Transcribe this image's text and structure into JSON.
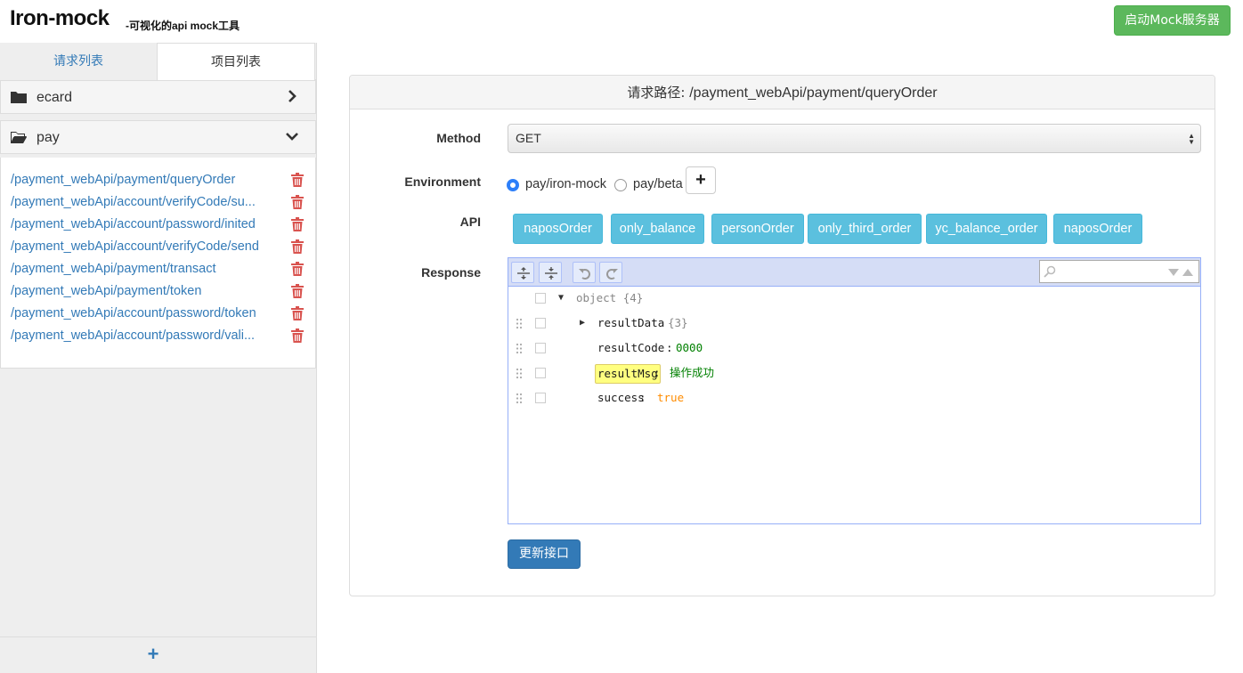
{
  "header": {
    "title": "Iron-mock",
    "subtitle": "-可视化的api mock工具",
    "start_button": "启动Mock服务器"
  },
  "sidebar": {
    "tabs": [
      {
        "label": "请求列表",
        "active": true
      },
      {
        "label": "项目列表",
        "active": false
      }
    ],
    "folders": [
      {
        "name": "ecard",
        "expanded": false,
        "icon": "folder-icon"
      },
      {
        "name": "pay",
        "expanded": true,
        "icon": "folder-open-icon"
      }
    ],
    "apis": [
      "/payment_webApi/payment/queryOrder",
      "/payment_webApi/account/verifyCode/su...",
      "/payment_webApi/account/password/inited",
      "/payment_webApi/account/verifyCode/send",
      "/payment_webApi/payment/transact",
      "/payment_webApi/payment/token",
      "/payment_webApi/account/password/token",
      "/payment_webApi/account/password/vali..."
    ],
    "add_label": "+"
  },
  "main": {
    "path_prefix": "请求路径: ",
    "path": "/payment_webApi/payment/queryOrder",
    "labels": {
      "method": "Method",
      "environment": "Environment",
      "api": "API",
      "response": "Response"
    },
    "method_value": "GET",
    "environments": [
      {
        "label": "pay/iron-mock",
        "checked": true
      },
      {
        "label": "pay/beta",
        "checked": false
      }
    ],
    "env_add": "+",
    "api_buttons": [
      "naposOrder",
      "only_balance",
      "personOrder",
      "only_third_order",
      "yc_balance_order",
      "naposOrder"
    ],
    "tree": {
      "root_key": "object",
      "root_count": "{4}",
      "fields": [
        {
          "key": "resultData",
          "meta": "{3}",
          "type": "object"
        },
        {
          "key": "resultCode",
          "value": "0000",
          "type": "number"
        },
        {
          "key": "resultMsg",
          "value": "操作成功",
          "type": "string",
          "highlighted": true
        },
        {
          "key": "success",
          "value": "true",
          "type": "boolean"
        }
      ]
    },
    "colon": " : ",
    "update_button": "更新接口"
  },
  "colors": {
    "success_green": "#5cb85c",
    "info_blue": "#5bc0de",
    "primary_blue": "#337ab7",
    "link_blue": "#337ab7",
    "danger_red": "#d9534f",
    "editor_border": "#97b0f8"
  }
}
